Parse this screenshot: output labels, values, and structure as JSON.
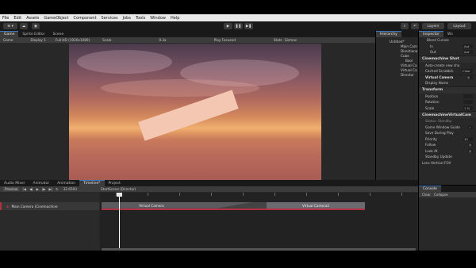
{
  "menu": [
    "File",
    "Edit",
    "Assets",
    "GameObject",
    "Component",
    "Services",
    "Jobs",
    "Tools",
    "Window",
    "Help"
  ],
  "toolbar": {
    "account": "⊕ ▾",
    "layers": "Layers",
    "layout": "Layout"
  },
  "scene_tabs": [
    "Game",
    "Sprite Editor",
    "Scene"
  ],
  "game_bar": {
    "display_mode": "Game",
    "display": "Display 1",
    "resolution": "Full HD (1920x1080)",
    "scale_label": "Scale",
    "scale_value": "0.3x",
    "play_mode": "Play Focused",
    "stats": "Stats",
    "gizmos": "Gizmos"
  },
  "hierarchy": {
    "tab": "Hierarchy",
    "items": [
      "Untitled*",
      "Main Cam",
      "Directiona",
      "Cube",
      "Bool",
      "Virtual Ca",
      "Virtual Ca",
      "Director"
    ]
  },
  "inspector": {
    "tab": "Inspector",
    "tab2": "Ws",
    "blend_curves": "Blend Curves",
    "in_label": "In",
    "in_value": "Aut",
    "out_label": "Out",
    "out_value": "Aut",
    "component_title": "Cinemachine Shot",
    "auto_create": "Auto-create new sho",
    "cached_scrubbing": "Cached Scrubbin",
    "clear": "Clear",
    "virtual_camera": "Virtual Camera",
    "display_name": "Display Name",
    "transform": "Transform",
    "position": "Position",
    "rotation": "Rotation",
    "scale": "Scale",
    "scale_value": "1 %",
    "cm_title": "CinemachineVirtualCam",
    "status": "Status: Standby",
    "game_window_guides": "Game Window Guide",
    "save_during_play": "Save During Play",
    "priority": "Priority",
    "priority_value": "10",
    "follow": "Follow",
    "look_at": "Look At",
    "standby_update": "Standby Update",
    "lens": "Lens Vertical FOV"
  },
  "bottom_tabs": [
    "Audio Mixer",
    "Animator",
    "Animation",
    "Timeline*",
    "Project"
  ],
  "timeline": {
    "preview": "Preview",
    "time": "32.6593",
    "breadcrumb": "StartScene (Director)",
    "track_name": "Main Camera (Cinemachine",
    "clip1": "Virtual Camera",
    "clip2": "Virtual Camera2"
  },
  "console": {
    "tab": "Console",
    "clear": "Clear",
    "collapse": "Collapse"
  },
  "colors": {
    "accent": "#3a79bb",
    "track_red": "#b33040",
    "clip": "#5a5a5f"
  }
}
